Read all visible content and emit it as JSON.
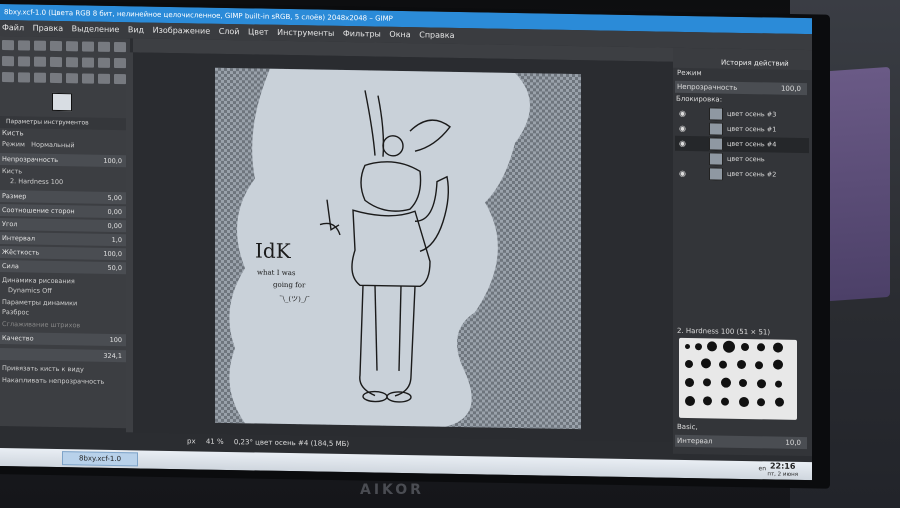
{
  "gimp": {
    "title": "8bxy.xcf-1.0 (Цвета RGB 8 бит, нелинейное целочисленное, GIMP built-in sRGB, 5 слоёв) 2048x2048 – GIMP",
    "menu": [
      "Файл",
      "Правка",
      "Выделение",
      "Вид",
      "Изображение",
      "Слой",
      "Цвет",
      "Инструменты",
      "Фильтры",
      "Окна",
      "Справка"
    ],
    "tool_options": {
      "header": "Параметры инструментов",
      "tool": "Кисть",
      "mode_label": "Режим",
      "mode_value": "Нормальный",
      "opacity_label": "Непрозрачность",
      "opacity_value": "100,0",
      "brush_label": "Кисть",
      "brush_value": "2. Hardness 100",
      "size_label": "Размер",
      "size_value": "5,00",
      "aspect_label": "Соотношение сторон",
      "aspect_value": "0,00",
      "angle_label": "Угол",
      "angle_value": "0,00",
      "spacing_label": "Интервал",
      "spacing_value": "1,0",
      "hardness_label": "Жёсткость",
      "hardness_value": "100,0",
      "force_label": "Сила",
      "force_value": "50,0",
      "dynamics_label": "Динамика рисования",
      "dynamics_value": "Dynamics Off",
      "dyn_params": "Параметры динамики",
      "jitter": "Разброс",
      "smooth": "Сглаживание штрихов",
      "quality_label": "Качество",
      "quality_value": "100",
      "factor_value": "324,1",
      "lock_brush": "Привязать кисть к виду",
      "incremental": "Накапливать непрозрачность"
    },
    "status": {
      "unit": "px",
      "zoom": "41 %",
      "info": "0,23° цвет осень #4 (184,5 МБ)"
    },
    "dock": {
      "history_tab": "История действий",
      "mode": "Режим",
      "opacity_label": "Непрозрачность",
      "opacity_value": "100,0",
      "lock_label": "Блокировка:",
      "layers": [
        "цвет осень #3",
        "цвет осень #1",
        "цвет осень #4",
        "цвет осень",
        "цвет осень #2"
      ],
      "brush_name": "2. Hardness 100 (51 × 51)",
      "preset": "Basic,",
      "spacing_label": "Интервал",
      "spacing_value": "10,0"
    },
    "taskbar": {
      "task": "8bxy.xcf-1.0",
      "lang": "en",
      "time": "22:16",
      "date": "пт, 2 июня"
    }
  },
  "laptop_logo": "AIKOR",
  "drawing_text": {
    "line1": "IdK",
    "line2": "what I was",
    "line3": "going for",
    "line4": "¯\\_(ツ)_/¯"
  },
  "colors": {
    "titlebar": "#2b8bd8",
    "canvas_bg": "#c8d0d8",
    "ui_dark": "#333539"
  }
}
